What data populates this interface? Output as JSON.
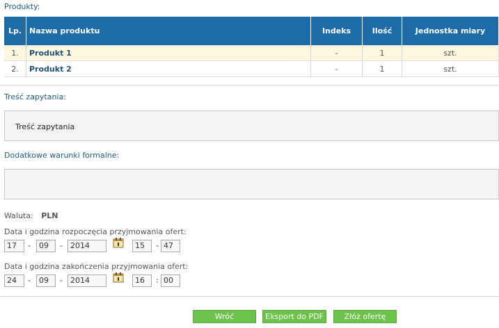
{
  "products_label": "Produkty:",
  "table": {
    "headers": [
      "Lp.",
      "Nazwa produktu",
      "Indeks",
      "Ilość",
      "Jednostka miary"
    ],
    "rows": [
      {
        "lp": "1.",
        "name": "Produkt 1",
        "index": "-",
        "qty": "1",
        "unit": "szt."
      },
      {
        "lp": "2.",
        "name": "Produkt 2",
        "index": "-",
        "qty": "1",
        "unit": "szt."
      }
    ]
  },
  "inquiry_label": "Treść zapytania:",
  "inquiry_text": "Treść zapytania",
  "conditions_label": "Dodatkowe warunki formalne:",
  "conditions_text": "",
  "currency": {
    "label": "Waluta:",
    "value": "PLN"
  },
  "start": {
    "label": "Data i godzina rozpoczęcia przyjmowania ofert:",
    "day": "17",
    "month": "09",
    "year": "2014",
    "hour": "15",
    "minute": "47"
  },
  "end": {
    "label": "Data i godzina zakończenia przyjmowania ofert:",
    "day": "24",
    "month": "09",
    "year": "2014",
    "hour": "16",
    "minute": "00"
  },
  "separators": {
    "date": "-",
    "time_start": "-",
    "time_end": ":"
  },
  "buttons": {
    "back": "Wróć",
    "export": "Eksport do PDF",
    "submit": "Złóż ofertę"
  },
  "colors": {
    "header_blue": "#1d6ca8",
    "button_green": "#6cc24a",
    "row_highlight": "#fcf8e0"
  }
}
